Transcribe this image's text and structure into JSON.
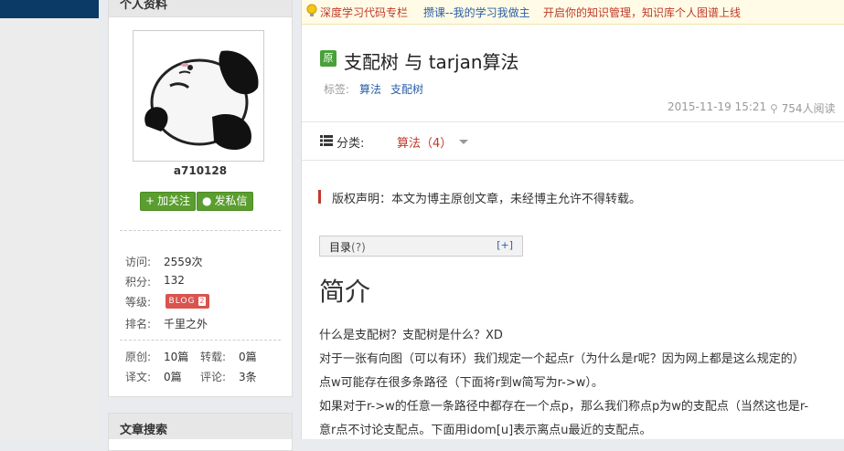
{
  "sidebar": {
    "profile_title": "个人资料",
    "username": "a710128",
    "follow_label": "加关注",
    "message_label": "发私信",
    "stats": {
      "visits_label": "访问:",
      "visits_value": "2559次",
      "points_label": "积分:",
      "points_value": "132",
      "level_label": "等级:",
      "level_badge": "BLOG",
      "level_num": "2",
      "rank_label": "排名:",
      "rank_value": "千里之外"
    },
    "counts": {
      "original_label": "原创:",
      "original_value": "10篇",
      "repost_label": "转载:",
      "repost_value": "0篇",
      "translate_label": "译文:",
      "translate_value": "0篇",
      "comment_label": "评论:",
      "comment_value": "3条"
    },
    "search_title": "文章搜索"
  },
  "notice": {
    "link1": "深度学习代码专栏",
    "link2": "攒课--我的学习我做主",
    "link3": "开启你的知识管理，知识库个人图谱上线"
  },
  "article": {
    "badge": "原",
    "title": "支配树 与 tarjan算法",
    "tags_label": "标签:",
    "tags": [
      "算法",
      "支配树"
    ],
    "date": "2015-11-19 15:21",
    "reads": "754人阅读",
    "category_label": "分类:",
    "category_value": "算法（4）",
    "copyright": "版权声明：本文为博主原创文章，未经博主允许不得转载。",
    "toc_title": "目录",
    "toc_help": "(?)",
    "toc_toggle": "[+]",
    "heading": "简介",
    "paragraphs": [
      "什么是支配树？支配树是什么？XD",
      "对于一张有向图（可以有环）我们规定一个起点r（为什么是r呢？因为网上都是这么规定的）",
      "点w可能存在很多条路径（下面将r到w简写为r->w）。",
      "如果对于r->w的任意一条路径中都存在一个点p，那么我们称点p为w的支配点（当然这也是r-",
      "意r点不讨论支配点。下面用idom[u]表示离点u最近的支配点。"
    ]
  },
  "colors": {
    "link_blue": "#2a5fa8",
    "accent_red": "#c0392b",
    "button_green": "#5a9e2f",
    "badge_green": "#4aa03a"
  }
}
